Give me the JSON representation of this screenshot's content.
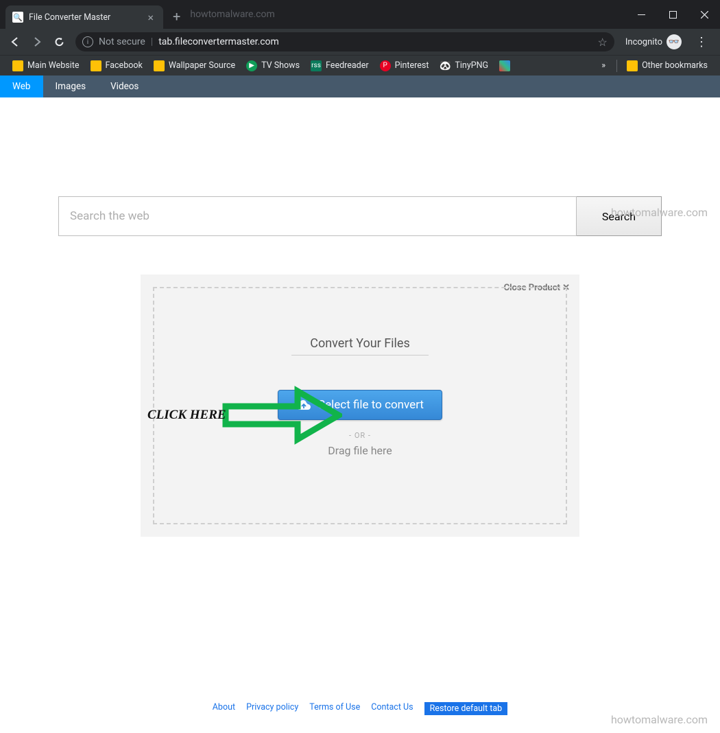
{
  "browser": {
    "tab_title": "File Converter Master",
    "titlebar_watermark": "howtomalware.com",
    "address": {
      "not_secure": "Not secure",
      "url": "tab.fileconvertermaster.com"
    },
    "incognito_label": "Incognito",
    "bookmarks": [
      {
        "label": "Main Website",
        "icon": "folder"
      },
      {
        "label": "Facebook",
        "icon": "folder"
      },
      {
        "label": "Wallpaper Source",
        "icon": "folder"
      },
      {
        "label": "TV Shows",
        "icon": "green"
      },
      {
        "label": "Feedreader",
        "icon": "feedreader"
      },
      {
        "label": "Pinterest",
        "icon": "pinterest"
      },
      {
        "label": "TinyPNG",
        "icon": "tinypng"
      }
    ],
    "other_bookmarks": "Other bookmarks"
  },
  "page": {
    "tabs": {
      "web": "Web",
      "images": "Images",
      "videos": "Videos"
    },
    "search": {
      "placeholder": "Search the web",
      "button": "Search"
    },
    "card": {
      "close": "Close Product",
      "title": "Convert Your Files",
      "select_button": "Select file to convert",
      "or": "- OR -",
      "drag": "Drag file here"
    },
    "annot": "CLICK HERE",
    "footer": {
      "about": "About",
      "privacy": "Privacy policy",
      "terms": "Terms of Use",
      "contact": "Contact Us",
      "restore": "Restore default tab"
    },
    "watermark": "howtomalware.com"
  }
}
